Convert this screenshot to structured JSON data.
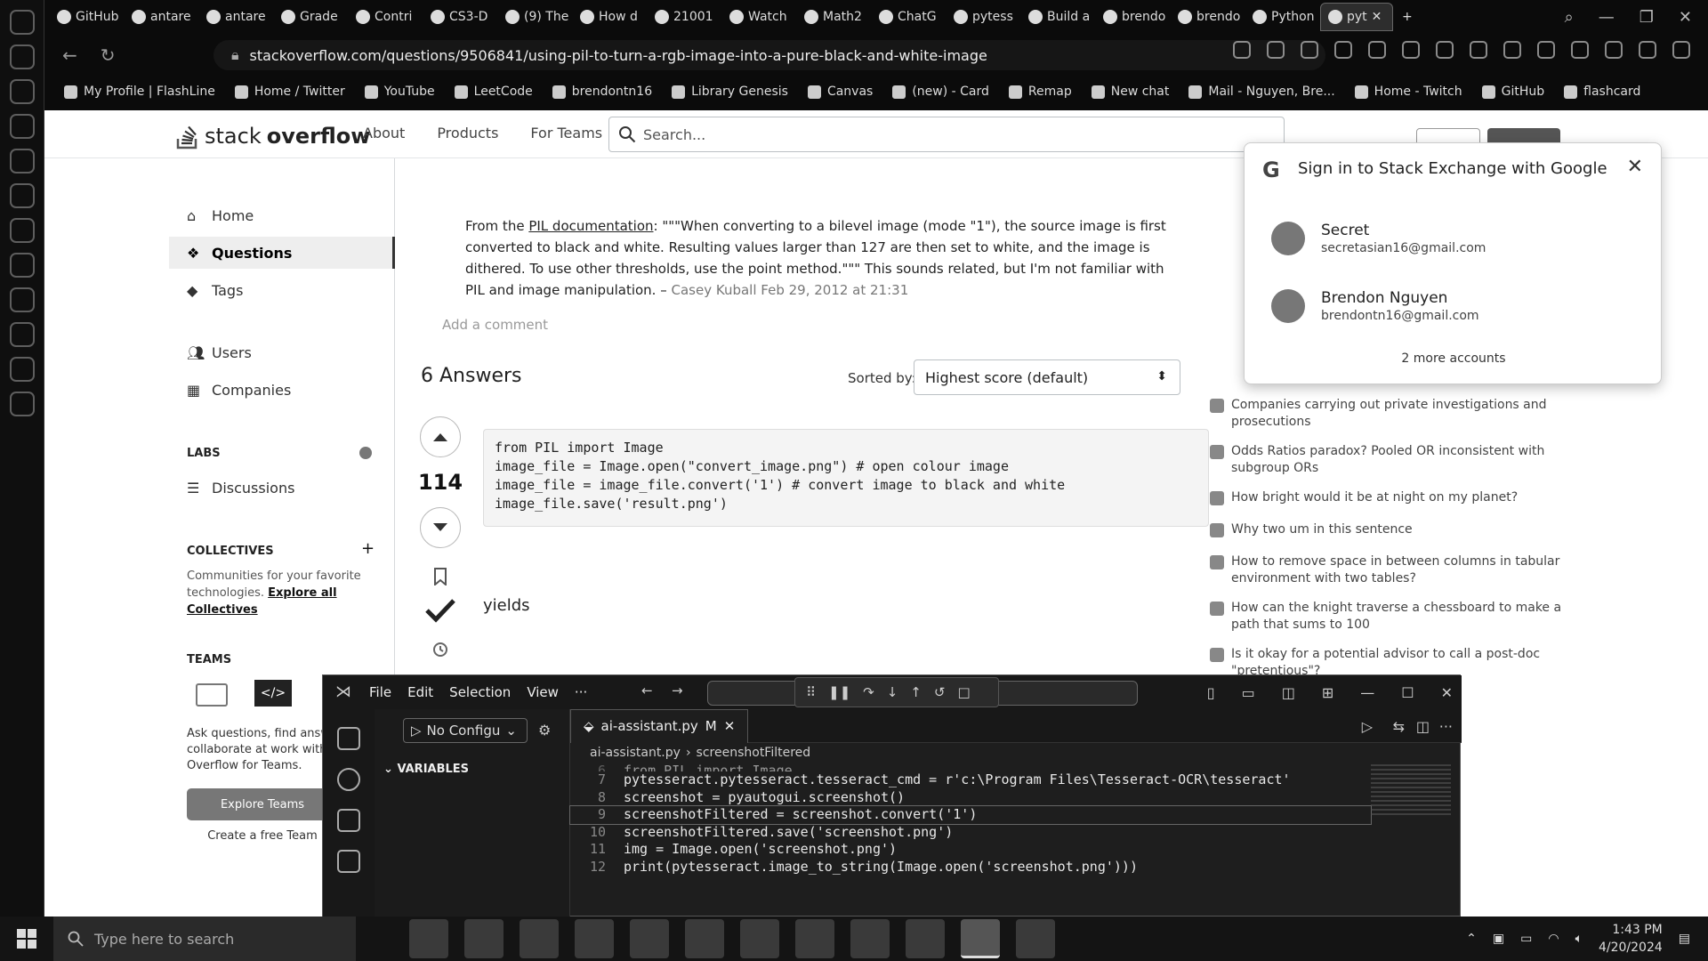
{
  "browser": {
    "tabs": [
      "GitHub",
      "antare",
      "antare",
      "Grade",
      "Contri",
      "CS3-D",
      "(9) The",
      "How d",
      "21001",
      "Watch",
      "Math2",
      "ChatG",
      "pytess",
      "Build a",
      "brendo",
      "brendo",
      "Python",
      "pyt"
    ],
    "url": "stackoverflow.com/questions/9506841/using-pil-to-turn-a-rgb-image-into-a-pure-black-and-white-image",
    "bookmarks": [
      "My Profile | FlashLine",
      "Home / Twitter",
      "YouTube",
      "LeetCode",
      "brendontn16",
      "Library Genesis",
      "Canvas",
      "(new) - Card",
      "Remap",
      "New chat",
      "Mail - Nguyen, Bre...",
      "Home - Twitch",
      "GitHub",
      "flashcard"
    ]
  },
  "so": {
    "logo_plain": "stack",
    "logo_bold": "overflow",
    "nav": [
      "About",
      "Products",
      "For Teams"
    ],
    "search_placeholder": "Search...",
    "sidebar": {
      "home": "Home",
      "questions": "Questions",
      "tags": "Tags",
      "users": "Users",
      "companies": "Companies",
      "labs_head": "LABS",
      "discussions": "Discussions",
      "collectives_head": "COLLECTIVES",
      "collectives_text": "Communities for your favorite technologies.",
      "collectives_link": "Explore all Collectives",
      "teams_head": "TEAMS",
      "teams_desc": "Ask questions, find answers and collaborate at work with Stack Overflow for Teams.",
      "explore_teams": "Explore Teams",
      "create_team": "Create a free Team"
    },
    "comment": {
      "prefix": "From the ",
      "link": "PIL documentation",
      "body": ": \"\"\"When converting to a bilevel image (mode \"1\"), the source image is first converted to black and white. Resulting values larger than 127 are then set to white, and the image is dithered. To use other thresholds, use the point method.\"\"\" This sounds related, but I'm not familiar with PIL and image manipulation. –",
      "author": "Casey Kuball",
      "date": "Feb 29, 2012 at 21:31"
    },
    "add_comment": "Add a comment",
    "answers_title": "6 Answers",
    "sorted_by": "Sorted by:",
    "sort_value": "Highest score (default)",
    "vote_count": "114",
    "code": "from PIL import Image\nimage_file = Image.open(\"convert_image.png\") # open colour image\nimage_file = image_file.convert('1') # convert image to black and white\nimage_file.save('result.png')",
    "yields": "yields",
    "hot_questions": [
      "Companies carrying out private investigations and prosecutions",
      "Odds Ratios paradox? Pooled OR inconsistent with subgroup ORs",
      "How bright would it be at night on my planet?",
      "Why two um in this sentence",
      "How to remove space in between columns in tabular environment with two tables?",
      "How can the knight traverse a chessboard to make a path that sums to 100",
      "Is it okay for a potential advisor to call a post-doc \"pretentious\"?"
    ]
  },
  "google_popup": {
    "title": "Sign in to Stack Exchange with Google",
    "accounts": [
      {
        "name": "Secret",
        "email": "secretasian16@gmail.com"
      },
      {
        "name": "Brendon Nguyen",
        "email": "brendontn16@gmail.com"
      }
    ],
    "more": "2 more accounts"
  },
  "vscode": {
    "menu": [
      "File",
      "Edit",
      "Selection",
      "View",
      "···"
    ],
    "run_config": "No Configu",
    "variables": "VARIABLES",
    "tab": "ai-assistant.py",
    "tab_badge": "M",
    "breadcrumb_file": "ai-assistant.py",
    "breadcrumb_symbol": "screenshotFiltered",
    "code_lines": [
      {
        "n": "6",
        "t": "from PIL import Image"
      },
      {
        "n": "7",
        "t": "pytesseract.pytesseract.tesseract_cmd = r'c:\\Program Files\\Tesseract-OCR\\tesseract'"
      },
      {
        "n": "8",
        "t": "screenshot = pyautogui.screenshot()"
      },
      {
        "n": "9",
        "t": "screenshotFiltered = screenshot.convert('1')"
      },
      {
        "n": "10",
        "t": "screenshotFiltered.save('screenshot.png')"
      },
      {
        "n": "11",
        "t": "img = Image.open('screenshot.png')"
      },
      {
        "n": "12",
        "t": "print(pytesseract.image_to_string(Image.open('screenshot.png')))"
      }
    ]
  },
  "taskbar": {
    "search_placeholder": "Type here to search",
    "time": "1:43 PM",
    "date": "4/20/2024"
  }
}
